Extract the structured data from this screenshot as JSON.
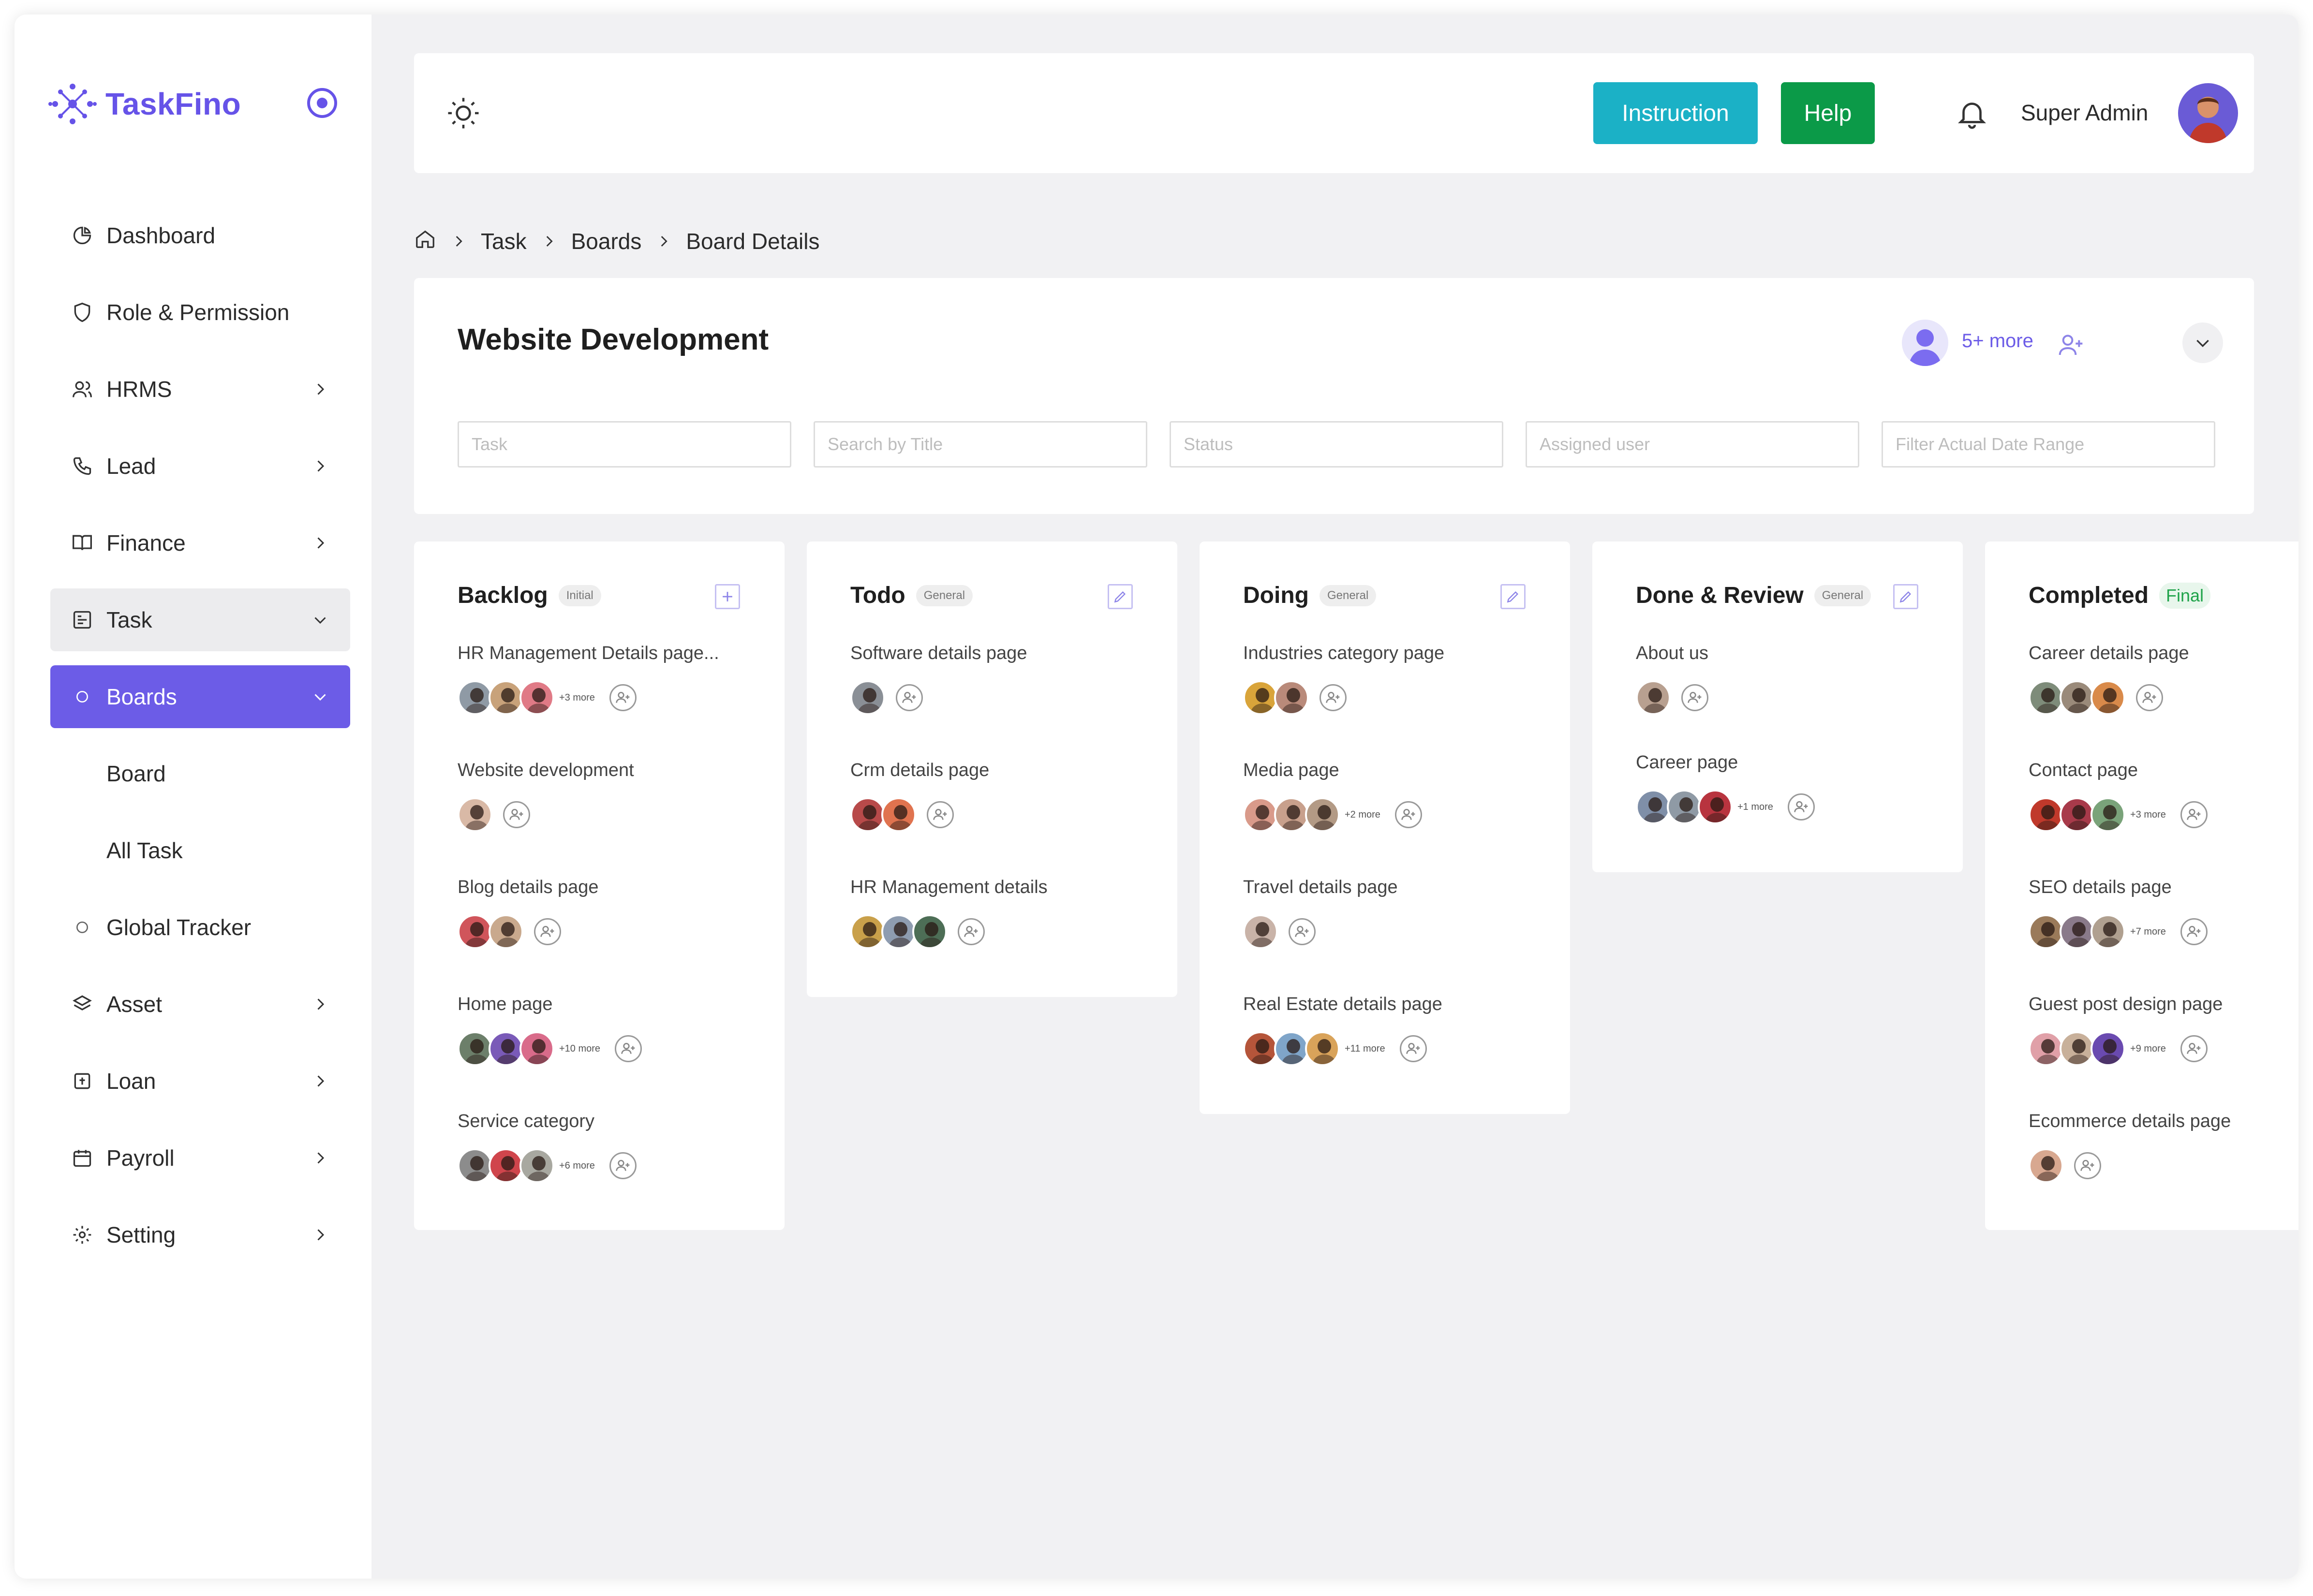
{
  "brand": {
    "name": "TaskFino",
    "accent": "#6653e8"
  },
  "sidebar": {
    "items": [
      {
        "label": "Dashboard",
        "icon": "pie-chart-icon"
      },
      {
        "label": "Role & Permission",
        "icon": "shield-icon"
      },
      {
        "label": "HRMS",
        "icon": "users-icon"
      },
      {
        "label": "Lead",
        "icon": "phone-icon"
      },
      {
        "label": "Finance",
        "icon": "book-icon"
      },
      {
        "label": "Task",
        "icon": "task-icon"
      },
      {
        "label": "Boards",
        "icon": "circle-icon"
      },
      {
        "label": "Board"
      },
      {
        "label": "All Task"
      },
      {
        "label": "Global Tracker",
        "icon": "circle-icon"
      },
      {
        "label": "Asset",
        "icon": "layers-icon"
      },
      {
        "label": "Loan",
        "icon": "loan-icon"
      },
      {
        "label": "Payroll",
        "icon": "calendar-icon"
      },
      {
        "label": "Setting",
        "icon": "gear-icon"
      }
    ]
  },
  "header": {
    "instruction_label": "Instruction",
    "help_label": "Help",
    "user_name": "Super Admin",
    "instruction_color": "#1bb1c6",
    "help_color": "#0b9a48"
  },
  "breadcrumb": {
    "items": [
      "Task",
      "Boards",
      "Board Details"
    ]
  },
  "board": {
    "title": "Website Development",
    "members_more": "5+ more",
    "filters": {
      "task": "Task",
      "search": "Search by Title",
      "status": "Status",
      "assigned": "Assigned user",
      "date": "Filter Actual Date Range"
    }
  },
  "columns": [
    {
      "title": "Backlog",
      "tag": "Initial",
      "tasks": [
        {
          "name": "HR Management Details page...",
          "more": "+3 more"
        },
        {
          "name": "Website development",
          "more": ""
        },
        {
          "name": "Blog details page",
          "more": ""
        },
        {
          "name": "Home page",
          "more": "+10 more"
        },
        {
          "name": "Service category",
          "more": "+6 more"
        }
      ]
    },
    {
      "title": "Todo",
      "tag": "General",
      "tasks": [
        {
          "name": "Software details page",
          "more": ""
        },
        {
          "name": "Crm details page",
          "more": ""
        },
        {
          "name": "HR Management details",
          "more": ""
        }
      ]
    },
    {
      "title": "Doing",
      "tag": "General",
      "tasks": [
        {
          "name": "Industries category page",
          "more": ""
        },
        {
          "name": "Media page",
          "more": "+2 more"
        },
        {
          "name": "Travel details page",
          "more": ""
        },
        {
          "name": "Real Estate details page",
          "more": "+11 more"
        }
      ]
    },
    {
      "title": "Done & Review",
      "tag": "General",
      "tasks": [
        {
          "name": "About us",
          "more": ""
        },
        {
          "name": "Career page",
          "more": "+1 more"
        }
      ]
    },
    {
      "title": "Completed",
      "tag": "Final",
      "tasks": [
        {
          "name": "Career details page",
          "more": ""
        },
        {
          "name": "Contact page",
          "more": "+3 more"
        },
        {
          "name": "SEO details page",
          "more": "+7 more"
        },
        {
          "name": "Guest post design page",
          "more": "+9 more"
        },
        {
          "name": "Ecommerce details page",
          "more": ""
        }
      ]
    }
  ]
}
